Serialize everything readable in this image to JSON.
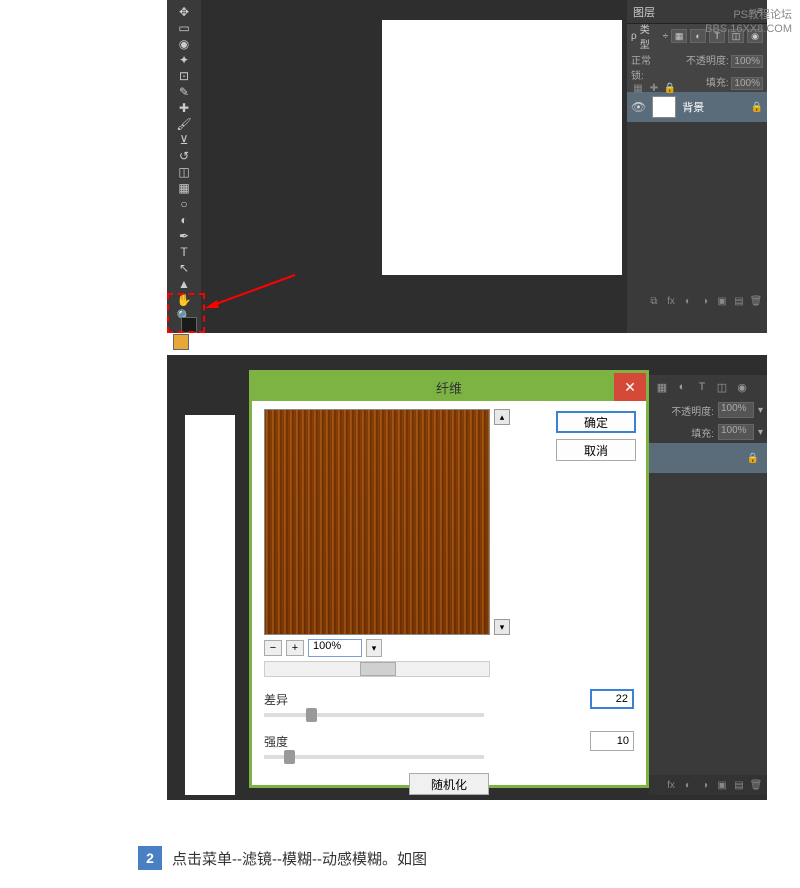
{
  "watermark": {
    "line1": "PS教程论坛",
    "line2": "BBS.16XX8.COM"
  },
  "screenshot1": {
    "layers_panel_title": "图层",
    "type_label": "类型",
    "blend_mode": "正常",
    "opacity_label": "不透明度:",
    "opacity_value": "100%",
    "lock_label": "锁:",
    "fill_label": "填充:",
    "fill_value": "100%",
    "layers": [
      {
        "name": "背景"
      }
    ]
  },
  "dialog": {
    "title": "纤维",
    "ok": "确定",
    "cancel": "取消",
    "zoom": "100%",
    "variance_label": "差异",
    "variance_value": "22",
    "strength_label": "强度",
    "strength_value": "10",
    "randomize": "随机化"
  },
  "panel2": {
    "opacity_label": "不透明度:",
    "opacity_value": "100%",
    "fill_label": "填充:",
    "fill_value": "100%"
  },
  "step": {
    "num": "2",
    "text": "点击菜单--滤镜--模糊--动感模糊。如图"
  }
}
